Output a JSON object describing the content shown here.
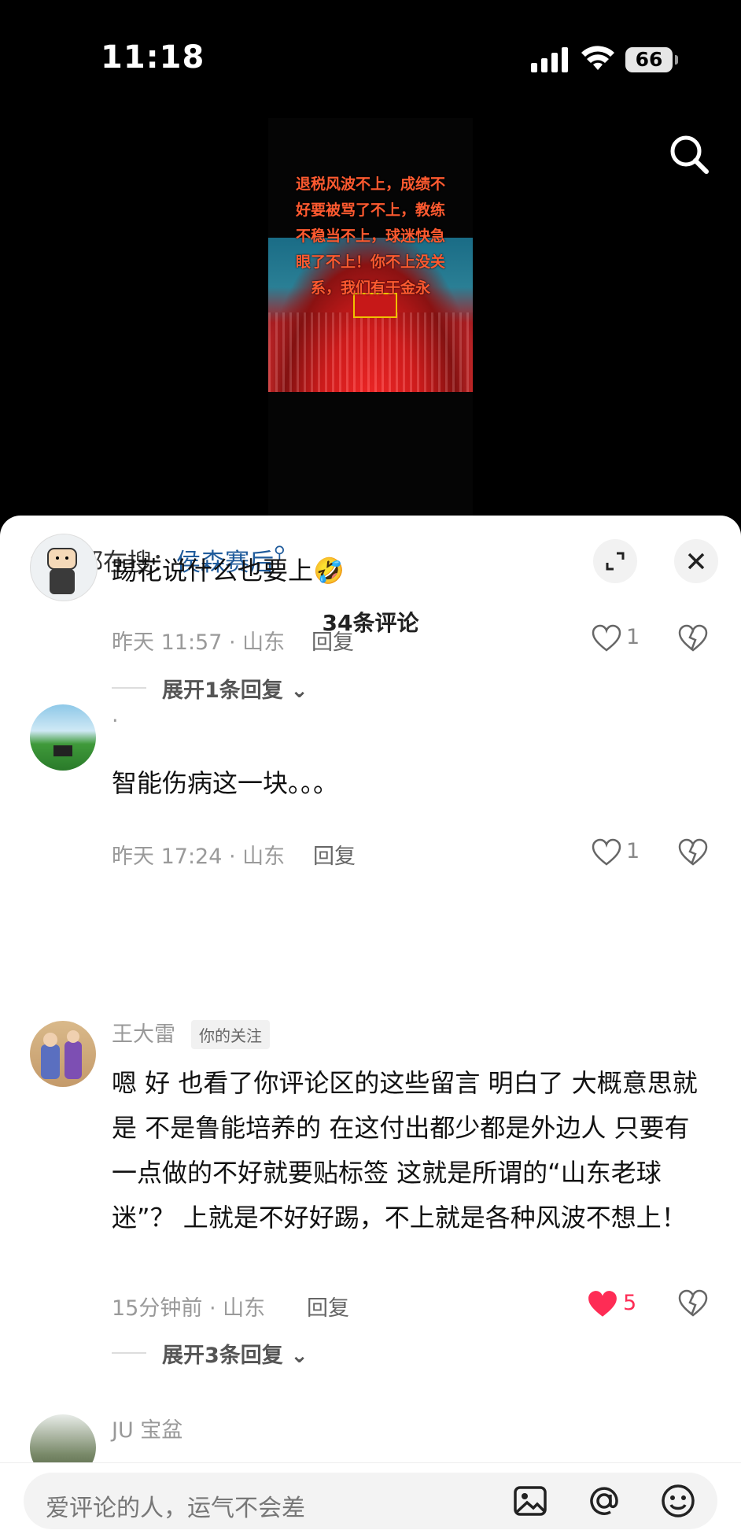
{
  "status_bar": {
    "time": "11:18",
    "battery": "66"
  },
  "video": {
    "overlay_lines": [
      "退税风波不上，成绩不",
      "好要被骂了不上，教练",
      "不稳当不上，球迷快急",
      "眼了不上！你不上没关",
      "系，我们有于金永"
    ]
  },
  "sheet": {
    "hot_search_prefix": "大家都在搜：",
    "hot_search_keyword": "侯森赛后",
    "comment_count": "34条评论"
  },
  "comments": [
    {
      "username": "",
      "text": "踢花说什么也要上🤣",
      "time_location": "昨天 11:57 · 山东",
      "reply_label": "回复",
      "likes": "1",
      "expand_label": "展开1条回复"
    },
    {
      "username": ".",
      "text": "智能伤病这一块。。。",
      "time_location": "昨天 17:24 · 山东",
      "reply_label": "回复",
      "likes": "1"
    },
    {
      "username": "王大雷",
      "tag": "你的关注",
      "text": "嗯 好 也看了你评论区的这些留言 明白了 大概意思就是 不是鲁能培养的 在这付出都少都是外边人 只要有一点做的不好就要贴标签 这就是所谓的“山东老球迷”？ 上就是不好好踢，不上就是各种风波不想上！",
      "time_location": "15分钟前 · 山东",
      "reply_label": "回复",
      "likes": "5",
      "liked_color": "#fe2c55",
      "expand_label": "展开3条回复"
    },
    {
      "username": "JU 宝盆"
    }
  ],
  "input": {
    "placeholder": "爱评论的人，运气不会差"
  }
}
